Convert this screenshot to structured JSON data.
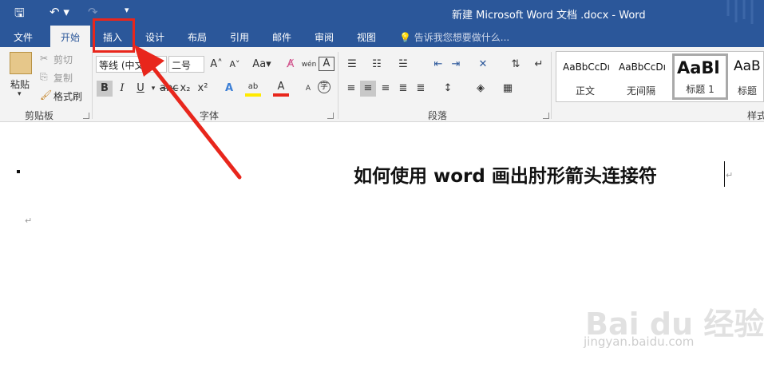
{
  "window": {
    "title": "新建 Microsoft Word 文档 .docx - Word",
    "quick_access": [
      "save-icon",
      "undo-icon",
      "redo-icon",
      "customize-icon"
    ]
  },
  "tabs": [
    {
      "label": "文件"
    },
    {
      "label": "开始"
    },
    {
      "label": "插入"
    },
    {
      "label": "设计"
    },
    {
      "label": "布局"
    },
    {
      "label": "引用"
    },
    {
      "label": "邮件"
    },
    {
      "label": "审阅"
    },
    {
      "label": "视图"
    }
  ],
  "active_tab": "开始",
  "tell_me": "告诉我您想要做什么...",
  "clipboard": {
    "paste": "粘贴",
    "cut": "剪切",
    "copy": "复制",
    "format_painter": "格式刷",
    "label": "剪贴板"
  },
  "font": {
    "name": "等线 (中文正",
    "size": "二号",
    "label": "字体",
    "case_btn": "Aa",
    "bold": "B",
    "italic": "I",
    "underline": "U"
  },
  "paragraph": {
    "label": "段落"
  },
  "styles": {
    "label": "样式",
    "items": [
      {
        "sample": "AaBbCcDı",
        "name": "正文"
      },
      {
        "sample": "AaBbCcDı",
        "name": "无间隔"
      },
      {
        "sample": "AaBl",
        "name": "标题 1"
      },
      {
        "sample": "AaB",
        "name": "标题"
      }
    ]
  },
  "document": {
    "heading": "如何使用 word 画出肘形箭头连接符"
  },
  "watermark": {
    "brand": "Bai du 经验",
    "url": "jingyan.baidu.com"
  },
  "colors": {
    "accent": "#2b579a",
    "annotation": "#e8261c"
  }
}
